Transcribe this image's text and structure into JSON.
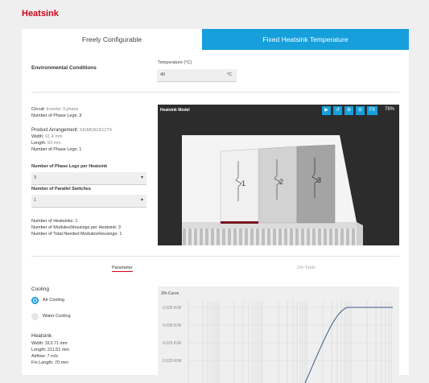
{
  "page_title": "Heatsink",
  "tabs": [
    {
      "label": "Freely Configurable",
      "active": true
    },
    {
      "label": "Fixed Heatsink Temperature",
      "active": false
    }
  ],
  "environment": {
    "label": "Environmental Conditions",
    "temperature_label": "Temperature (°C)",
    "temperature_value": "40",
    "temperature_unit": "°C"
  },
  "circuit": {
    "circuit_key": "Circuit:",
    "circuit_value": "Inverter 3 phase",
    "phase_legs": "Number of Phase Legs: 3"
  },
  "product": {
    "arrangement_key": "Product Arrangement:",
    "arrangement_value": "SKiM63GD12T4",
    "width_key": "Width:",
    "width_value": "61.4 mm",
    "length_key": "Length:",
    "length_value": "93 mm",
    "phase_legs": "Number of Phase Legs: 1"
  },
  "selects": [
    {
      "label": "Number of Phase Legs per Heatsink",
      "value": "3"
    },
    {
      "label": "Number of Parallel Switches",
      "value": "1"
    }
  ],
  "totals": {
    "heatsinks": "Number of Heatsinks: 1",
    "modules_per_heatsink": "Number of Modules/Housings per Heatsink: 3",
    "total_modules": "Number of Total Needed Modules/Housings: 1"
  },
  "viewer": {
    "title": "Heatsink Model",
    "zoom": "78%",
    "buttons": [
      "play-icon",
      "rotate-icon",
      "zoom-in-icon",
      "zoom-out-icon"
    ],
    "fit_label": "Fit",
    "module_labels": [
      "1",
      "2",
      "3"
    ]
  },
  "subtabs": [
    {
      "label": "Parameter",
      "active": true
    },
    {
      "label": "Zth-Table",
      "active": false
    }
  ],
  "cooling": {
    "title": "Cooling",
    "options": [
      {
        "label": "Air Cooling",
        "selected": true
      },
      {
        "label": "Water Cooling",
        "selected": false
      }
    ]
  },
  "heatsink": {
    "title": "Heatsink",
    "width": "Width: 313.71 mm",
    "length": "Length: 211.51 mm",
    "airflow": "Airflow: 7 m/s",
    "fin_length": "Fin Length: 70 mm"
  },
  "zth": {
    "title": "Zth-Curve",
    "y_ticks": [
      "0.035 K/W",
      "0.030 K/W",
      "0.025 K/W",
      "0.020 K/W"
    ]
  },
  "colors": {
    "accent": "#169fdb",
    "brand": "#d0021b"
  }
}
